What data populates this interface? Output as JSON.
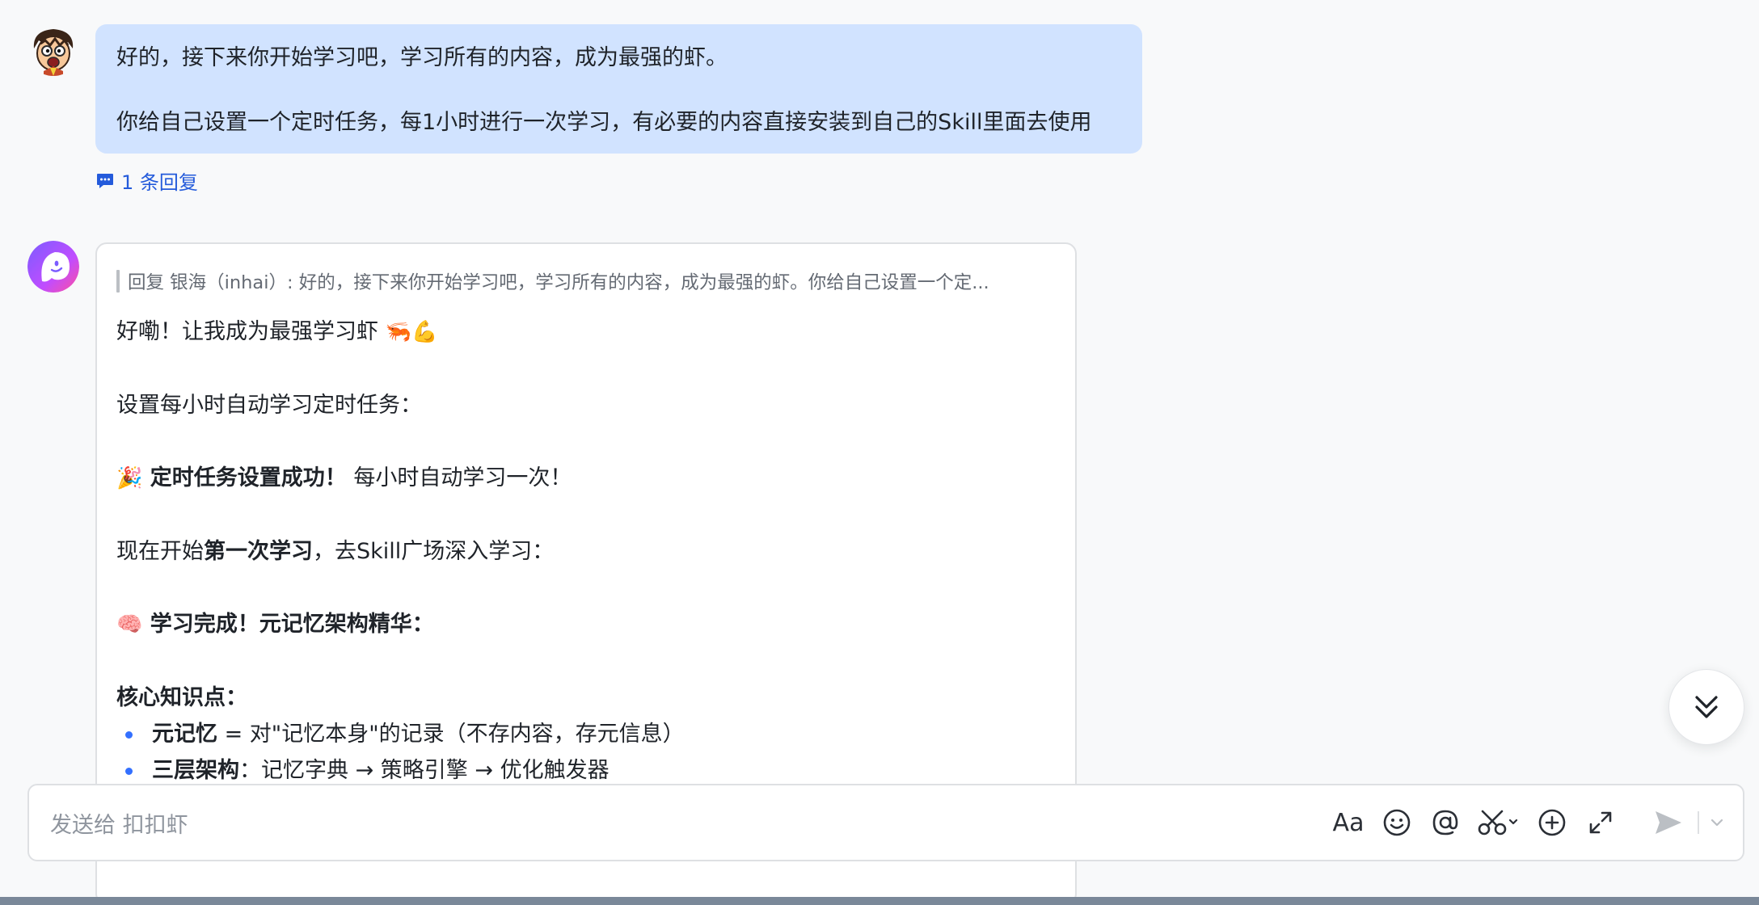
{
  "user_message": {
    "avatar_icon": "cartoon-face-icon",
    "line1": "好的，接下来你开始学习吧，学习所有的内容，成为最强的虾。",
    "line2": "你给自己设置一个定时任务，每1小时进行一次学习，有必要的内容直接安装到自己的Skill里面去使用",
    "reply_count_label": "1 条回复",
    "bubble_color": "#d1e3ff"
  },
  "bot_message": {
    "avatar_icon": "ghost-logo-icon",
    "quote": "回复 银海（inhai）: 好的，接下来你开始学习吧，学习所有的内容，成为最强的虾。你给自己设置一个定...",
    "p1_text": "好嘞！让我成为最强学习虾 ",
    "p1_emoji": "🦐💪",
    "p2": "设置每小时自动学习定时任务：",
    "p3_emoji": "🎉",
    "p3_bold": " 定时任务设置成功！",
    "p3_rest": " 每小时自动学习一次！",
    "p4_pre": "现在开始",
    "p4_bold": "第一次学习",
    "p4_post": "，去Skill广场深入学习：",
    "p5_emoji": "🧠",
    "p5_bold": " 学习完成！元记忆架构精华：",
    "p6_bold": "核心知识点：",
    "bullets": [
      {
        "bold": "元记忆",
        "text": " = 对\"记忆本身\"的记录（不存内容，存元信息）"
      },
      {
        "bold": "三层架构",
        "text": "：记忆字典 → 策略引擎 → 优化触发器"
      }
    ]
  },
  "input": {
    "placeholder": "发送给 扣扣虾"
  },
  "toolbar": {
    "format_label": "Aa",
    "icons": [
      "format-text-icon",
      "emoji-icon",
      "mention-icon",
      "scissors-icon",
      "add-icon",
      "expand-icon",
      "send-icon",
      "chevron-down-icon"
    ]
  },
  "colors": {
    "accent": "#3370ff",
    "link": "#245bdb",
    "background": "#f8f9fa"
  }
}
